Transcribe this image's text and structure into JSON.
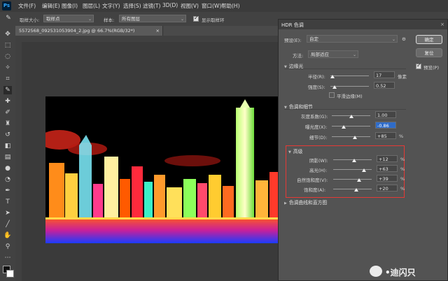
{
  "menubar": {
    "items": [
      "文件(F)",
      "编辑(E)",
      "图像(I)",
      "图层(L)",
      "文字(Y)",
      "选择(S)",
      "滤镜(T)",
      "3D(D)",
      "视图(V)",
      "窗口(W)",
      "帮助(H)"
    ]
  },
  "options": {
    "sample_size_label": "取样大小:",
    "sample_size_value": "取样点",
    "sample_label": "样本:",
    "sample_value": "所有图层",
    "show_ring_label": "显示取样环"
  },
  "document": {
    "tab_title": "5572568_092531053904_2.jpg @ 66.7%(RGB/32*)",
    "close": "×"
  },
  "dialog": {
    "title": "HDR 色调",
    "close": "×",
    "preset_label": "预设(E):",
    "preset_value": "自定",
    "method_label": "方法:",
    "method_value": "局部适应",
    "ok_label": "确定",
    "reset_label": "复位",
    "preview_label": "预览(P)",
    "edge_glow": {
      "title": "边缘光",
      "radius_label": "半径(R):",
      "radius_value": "17",
      "radius_unit": "像素",
      "radius_pos": 0.05,
      "strength_label": "强度(S):",
      "strength_value": "0.52",
      "strength_pos": 0.1,
      "smooth_label": "平滑边缘(M)"
    },
    "tone_detail": {
      "title": "色调和细节",
      "gamma_label": "灰度系数(G):",
      "gamma_value": "1.00",
      "gamma_pos": 0.5,
      "exposure_label": "曝光度(X):",
      "exposure_value": "-0.86",
      "exposure_pos": 0.3,
      "detail_label": "细节(D):",
      "detail_value": "+85",
      "detail_unit": "%",
      "detail_pos": 0.6
    },
    "advanced": {
      "title": "高级",
      "shadow_label": "阴影(W):",
      "shadow_value": "+12",
      "shadow_unit": "%",
      "shadow_pos": 0.55,
      "highlight_label": "高光(H):",
      "highlight_value": "+63",
      "highlight_unit": "%",
      "highlight_pos": 0.8,
      "vibrance_label": "自然饱和度(V):",
      "vibrance_value": "+39",
      "vibrance_unit": "%",
      "vibrance_pos": 0.68,
      "saturation_label": "饱和度(A):",
      "saturation_value": "+20",
      "saturation_unit": "%",
      "saturation_pos": 0.6
    },
    "curve_section": "色调曲线和直方图"
  },
  "watermark": {
    "text": "•迪闪只"
  },
  "colors": {
    "accent_selection": "#2f6cc9",
    "highlight_box": "#e53935"
  }
}
